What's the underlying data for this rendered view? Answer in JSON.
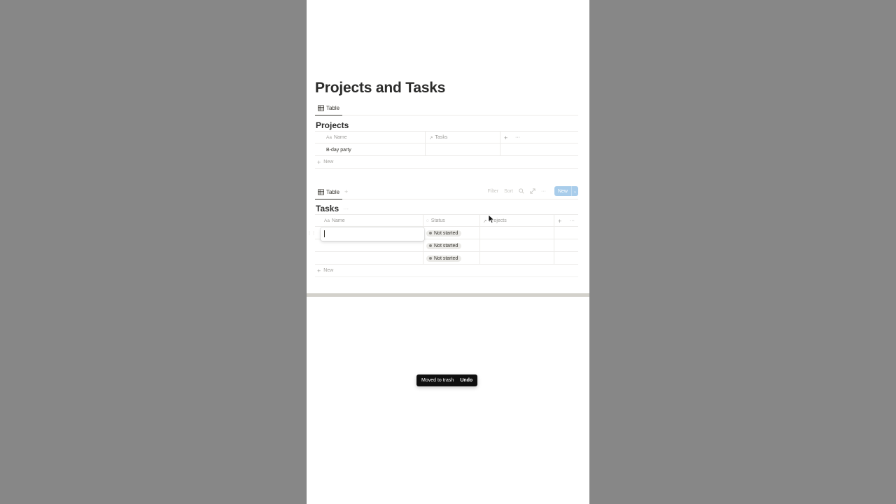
{
  "page": {
    "title": "Projects and Tasks"
  },
  "projects_view": {
    "tab_label": "Table",
    "db_title": "Projects",
    "columns": [
      {
        "icon": "Aa",
        "label": "Name"
      },
      {
        "icon": "↗",
        "label": "Tasks"
      }
    ],
    "add_column": "+",
    "more": "···",
    "rows": [
      {
        "name": "B-day party",
        "tasks": ""
      }
    ],
    "new_label": "New"
  },
  "tasks_view": {
    "tab_label": "Table",
    "add_view": "+",
    "tools": {
      "filter": "Filter",
      "sort": "Sort",
      "more": "···",
      "new_button": "New",
      "new_caret": "⌄"
    },
    "db_title": "Tasks",
    "title_more": "···",
    "columns": [
      {
        "icon": "Aa",
        "label": "Name"
      },
      {
        "icon": "◌",
        "label": "Status"
      },
      {
        "icon": "↗",
        "label": "Projects"
      }
    ],
    "add_column": "+",
    "more": "···",
    "rows": [
      {
        "name": "",
        "status": "Not started",
        "projects": ""
      },
      {
        "name": "",
        "status": "Not started",
        "projects": ""
      },
      {
        "name": "",
        "status": "Not started",
        "projects": ""
      }
    ],
    "new_label": "New",
    "editing_value": ""
  },
  "toast": {
    "message": "Moved to trash",
    "action": "Undo"
  },
  "colors": {
    "backdrop": "#878787",
    "new_button": "#a9cdeb",
    "toast_bg": "#0f0f0f"
  }
}
